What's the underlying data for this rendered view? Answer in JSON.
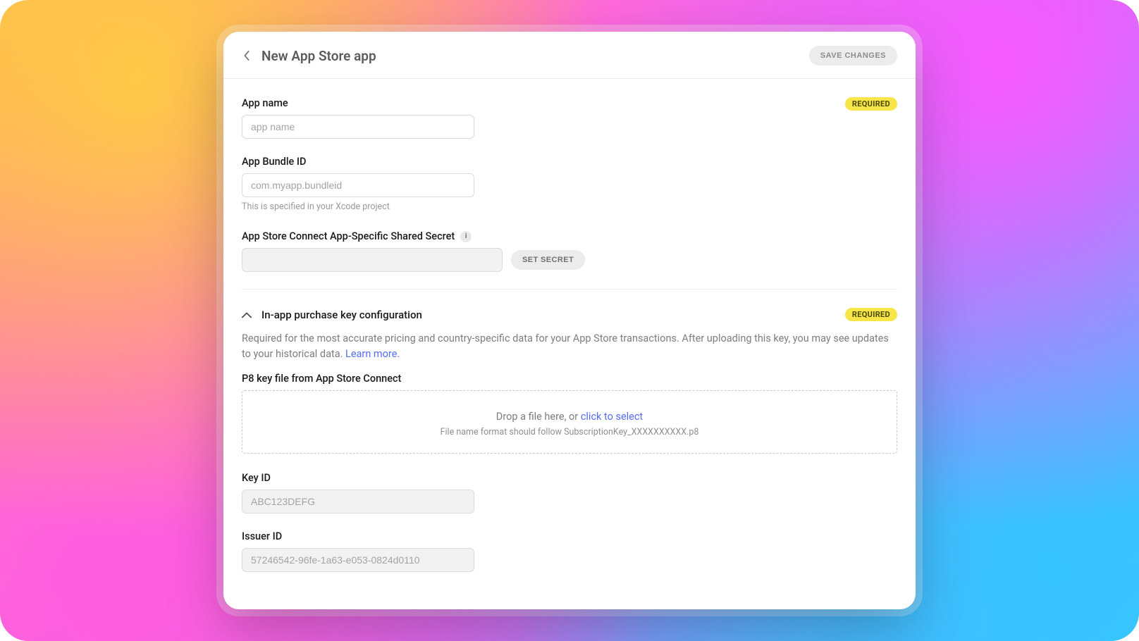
{
  "header": {
    "title": "New App Store app",
    "save_label": "SAVE CHANGES"
  },
  "fields": {
    "app_name": {
      "label": "App name",
      "placeholder": "app name",
      "required_badge": "REQUIRED"
    },
    "bundle_id": {
      "label": "App Bundle ID",
      "placeholder": "com.myapp.bundleid",
      "helper": "This is specified in your Xcode project"
    },
    "shared_secret": {
      "label": "App Store Connect App-Specific Shared Secret",
      "button": "SET SECRET"
    }
  },
  "section": {
    "title": "In-app purchase key configuration",
    "required_badge": "REQUIRED",
    "description": "Required for the most accurate pricing and country-specific data for your App Store transactions. After uploading this key, you may see updates to your historical data. ",
    "learn_more": "Learn more.",
    "p8": {
      "label": "P8 key file from App Store Connect",
      "drop_text": "Drop a file here, or ",
      "click_text": "click to select",
      "format_text": "File name format should follow SubscriptionKey_XXXXXXXXXX.p8"
    },
    "key_id": {
      "label": "Key ID",
      "placeholder": "ABC123DEFG"
    },
    "issuer_id": {
      "label": "Issuer ID",
      "placeholder": "57246542-96fe-1a63-e053-0824d0110"
    }
  }
}
